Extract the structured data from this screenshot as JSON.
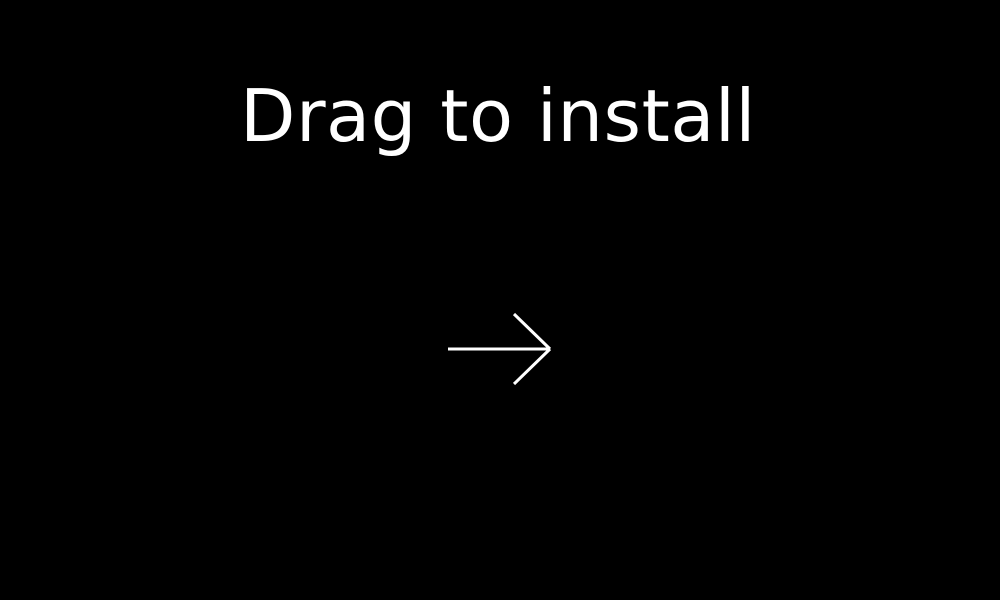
{
  "installer": {
    "instruction": "Drag to install",
    "arrow_icon": "right-arrow-icon",
    "background_color": "#000000",
    "foreground_color": "#ffffff"
  }
}
